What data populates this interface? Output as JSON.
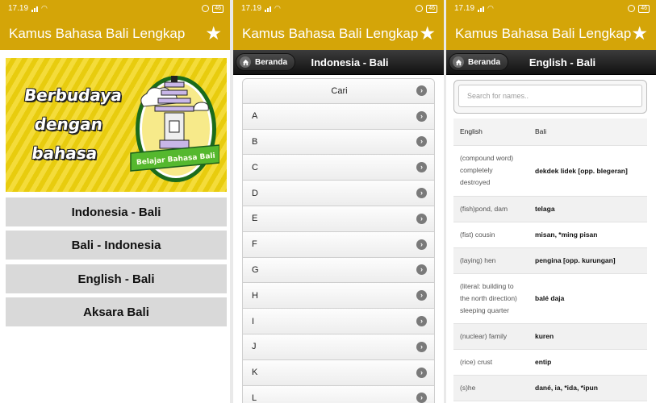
{
  "status": {
    "time": "17.19",
    "battery": "46"
  },
  "app": {
    "title": "Kamus Bahasa Bali Lengkap"
  },
  "home": {
    "banner_lines": [
      "Berbudaya",
      "dengan",
      "bahasa"
    ],
    "banner_ribbon": "Belajar Bahasa Bali",
    "menu": [
      "Indonesia - Bali",
      "Bali - Indonesia",
      "English - Bali",
      "Aksara Bali"
    ]
  },
  "indo_screen": {
    "back_label": "Beranda",
    "title": "Indonesia - Bali",
    "search_item": "Cari",
    "letters": [
      "A",
      "B",
      "C",
      "D",
      "E",
      "F",
      "G",
      "H",
      "I",
      "J",
      "K",
      "L"
    ]
  },
  "eng_screen": {
    "back_label": "Beranda",
    "title": "English - Bali",
    "search_placeholder": "Search for names..",
    "columns": [
      "English",
      "Bali"
    ],
    "rows": [
      {
        "english": "(compound word) completely destroyed",
        "bali": "dekdek lidek [opp. blegeran]"
      },
      {
        "english": "(fish)pond, dam",
        "bali": "telaga"
      },
      {
        "english": "(fist) cousin",
        "bali": "misan, *ming pisan"
      },
      {
        "english": "(laying) hen",
        "bali": "pengina [opp. kurungan]"
      },
      {
        "english": "(literal: building to the north direction) sleeping quarter",
        "bali": "balé daja"
      },
      {
        "english": "(nuclear) family",
        "bali": "kuren"
      },
      {
        "english": "(rice) crust",
        "bali": "entip"
      },
      {
        "english": "(s)he",
        "bali": "dané, ia, *ida, *ipun"
      }
    ]
  },
  "colors": {
    "accent": "#d4a508",
    "header_dark": "#1a1a1a",
    "menu_bg": "#d9d9d9"
  }
}
